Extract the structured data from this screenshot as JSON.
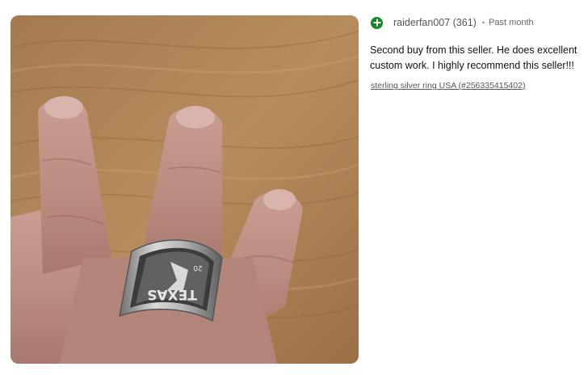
{
  "review": {
    "feedback_icon": "positive-plus-icon",
    "feedback_color": "#118a22",
    "username": "raiderfan007 (361)",
    "separator": "•",
    "time": "Past month",
    "comment": "Second buy from this seller. He does excellent\ncustom work. I highly recommend this seller!!!",
    "item_link": "sterling silver ring USA (#256335415402)"
  },
  "photo": {
    "ring_engraving": "TEXAS",
    "ring_small_text": "20"
  }
}
